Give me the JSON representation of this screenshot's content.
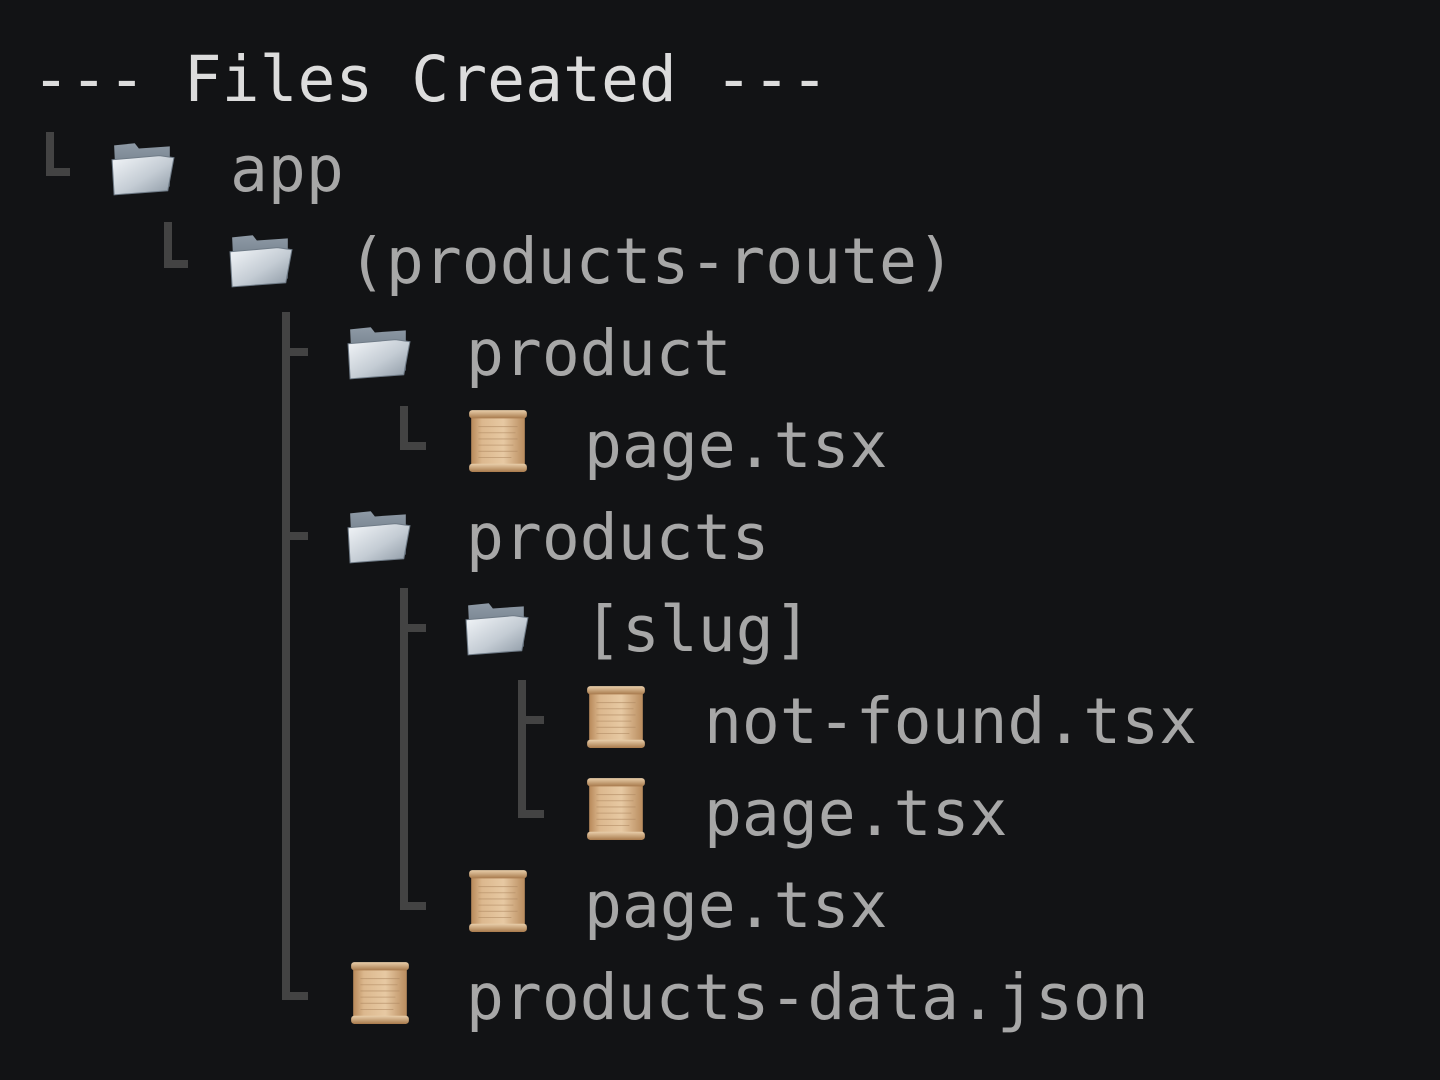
{
  "header": {
    "title": "--- Files Created ---"
  },
  "tree": {
    "app": {
      "label": "app",
      "icon": "folder-icon"
    },
    "products_route": {
      "label": "(products-route)",
      "icon": "folder-icon"
    },
    "product": {
      "label": "product",
      "icon": "folder-icon"
    },
    "product_page": {
      "label": "page.tsx",
      "icon": "file-scroll-icon"
    },
    "products": {
      "label": "products",
      "icon": "folder-icon"
    },
    "slug": {
      "label": "[slug]",
      "icon": "folder-icon"
    },
    "slug_not_found": {
      "label": "not-found.tsx",
      "icon": "file-scroll-icon"
    },
    "slug_page": {
      "label": "page.tsx",
      "icon": "file-scroll-icon"
    },
    "products_page": {
      "label": "page.tsx",
      "icon": "file-scroll-icon"
    },
    "products_data": {
      "label": "products-data.json",
      "icon": "file-scroll-icon"
    }
  },
  "colors": {
    "background": "#121315",
    "header_text": "#dcdcdc",
    "item_text": "#a7a7a7",
    "tree_lines": "#434343"
  }
}
